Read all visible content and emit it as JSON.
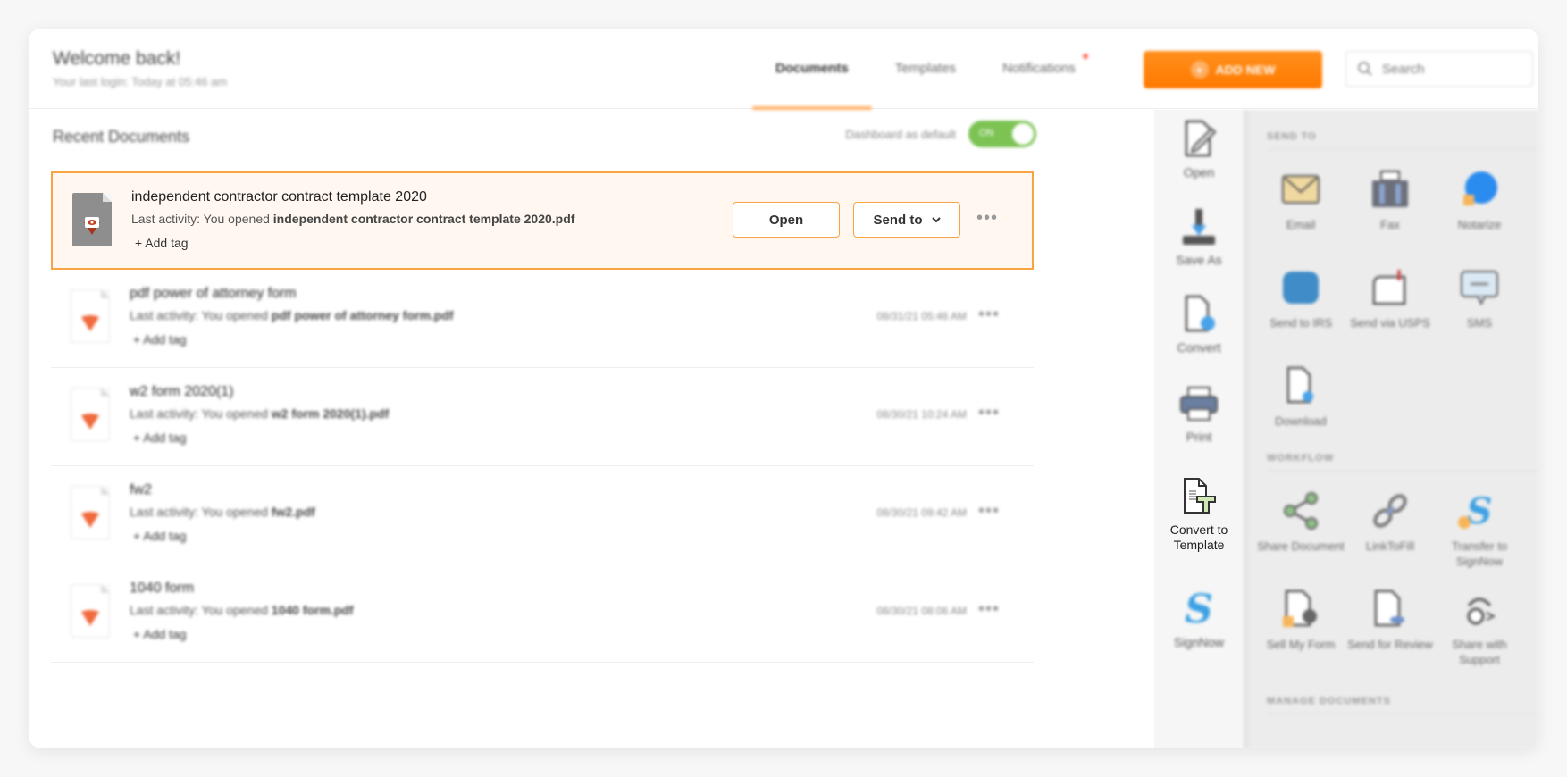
{
  "header": {
    "title": "Welcome back!",
    "last_login": "Your last login: Today at 05:46 am",
    "tabs": [
      {
        "label": "Documents",
        "active": true
      },
      {
        "label": "Templates",
        "active": false
      },
      {
        "label": "Notifications",
        "active": false,
        "has_dot": true
      }
    ],
    "add_new_label": "ADD NEW",
    "search_placeholder": "Search"
  },
  "main": {
    "title": "Recent Documents",
    "default_toggle": {
      "label": "Dashboard as default",
      "state": "ON"
    },
    "documents": [
      {
        "name": "independent contractor contract template 2020",
        "activity_prefix": "Last activity: You opened ",
        "activity_file": "independent contractor contract template 2020.pdf",
        "add_tag": "+ Add tag",
        "selected": true,
        "open_label": "Open",
        "send_label": "Send to"
      },
      {
        "name": "pdf power of attorney form",
        "activity_prefix": "Last activity: You opened ",
        "activity_file": "pdf power of attorney form.pdf",
        "add_tag": "+ Add tag",
        "date": "08/31/21 05:46 AM"
      },
      {
        "name": "w2 form 2020(1)",
        "activity_prefix": "Last activity: You opened ",
        "activity_file": "w2 form 2020(1).pdf",
        "add_tag": "+ Add tag",
        "date": "08/30/21 10:24 AM"
      },
      {
        "name": "fw2",
        "activity_prefix": "Last activity: You opened ",
        "activity_file": "fw2.pdf",
        "add_tag": "+ Add tag",
        "date": "08/30/21 09:42 AM"
      },
      {
        "name": "1040 form",
        "activity_prefix": "Last activity: You opened ",
        "activity_file": "1040 form.pdf",
        "add_tag": "+ Add tag",
        "date": "08/30/21 08:06 AM"
      }
    ]
  },
  "tools": [
    {
      "label": "Open",
      "icon": "edit-document-icon"
    },
    {
      "label": "Save As",
      "icon": "save-as-icon"
    },
    {
      "label": "Convert",
      "icon": "convert-icon"
    },
    {
      "label": "Print",
      "icon": "printer-icon"
    },
    {
      "label": "Convert to Template",
      "icon": "template-icon",
      "active": true
    },
    {
      "label": "SignNow",
      "icon": "signnow-icon"
    }
  ],
  "panel": {
    "send_to_title": "SEND TO",
    "send_to": [
      {
        "label": "Email",
        "icon": "email-icon"
      },
      {
        "label": "Fax",
        "icon": "fax-icon"
      },
      {
        "label": "Notarize",
        "icon": "notarize-icon"
      },
      {
        "label": "Send to IRS",
        "icon": "irs-icon"
      },
      {
        "label": "Send via USPS",
        "icon": "mailbox-icon"
      },
      {
        "label": "SMS",
        "icon": "sms-icon"
      },
      {
        "label": "Download",
        "icon": "download-icon"
      }
    ],
    "workflow_title": "WORKFLOW",
    "workflow": [
      {
        "label": "Share Document",
        "icon": "share-icon"
      },
      {
        "label": "LinkToFill",
        "icon": "link-icon"
      },
      {
        "label": "Transfer to SignNow",
        "icon": "transfer-icon"
      },
      {
        "label": "Sell My Form",
        "icon": "sell-form-icon"
      },
      {
        "label": "Send for Review",
        "icon": "review-icon"
      },
      {
        "label": "Share with Support",
        "icon": "support-icon"
      }
    ],
    "manage_title": "MANAGE DOCUMENTS"
  },
  "colors": {
    "accent": "#ff7a00",
    "selected_border": "#f7a442",
    "selected_bg": "#fff7f0",
    "toggle_on": "#7cc354",
    "notification_dot": "#ff6b57"
  }
}
